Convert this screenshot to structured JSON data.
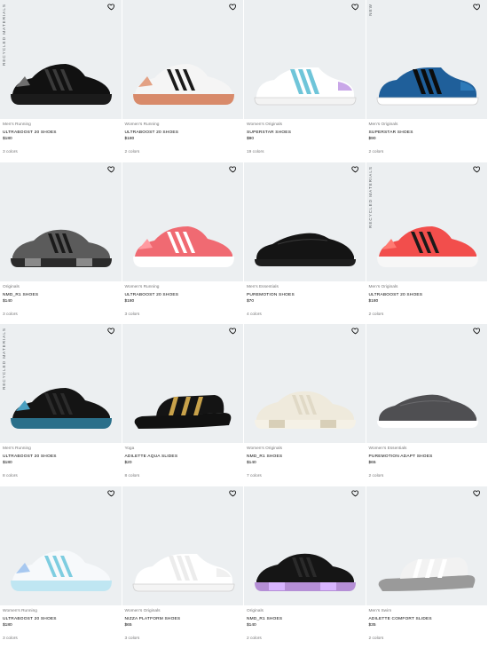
{
  "products": [
    {
      "category": "Men's Running",
      "name": "ULTRABOOST 20 SHOES",
      "price": "$180",
      "colors": "3 colors",
      "badge": "RECYCLED MATERIALS",
      "shoe": {
        "type": "runner",
        "body": "#111111",
        "sole": "#1b1b1b",
        "stripe": "#3a3a3a",
        "accent": "#6f6f6f"
      }
    },
    {
      "category": "Women's Running",
      "name": "ULTRABOOST 20 SHOES",
      "price": "$180",
      "colors": "2 colors",
      "badge": "",
      "shoe": {
        "type": "runner",
        "body": "#f5f5f5",
        "sole": "#d88a6a",
        "stripe": "#1a1a1a",
        "accent": "#e3a184"
      }
    },
    {
      "category": "Women's Originals",
      "name": "SUPERSTAR SHOES",
      "price": "$90",
      "colors": "19 colors",
      "badge": "",
      "shoe": {
        "type": "superstar",
        "body": "#ffffff",
        "sole": "#f3f3f3",
        "stripe": "#6fc5d9",
        "accent": "#c9a7e8"
      }
    },
    {
      "category": "Men's Originals",
      "name": "SUPERSTAR SHOES",
      "price": "$90",
      "colors": "2 colors",
      "badge": "NEW",
      "shoe": {
        "type": "superstar",
        "body": "#1f5f9a",
        "sole": "#ffffff",
        "stripe": "#0c0c0c",
        "accent": "#2d7ab9"
      }
    },
    {
      "category": "Originals",
      "name": "NMD_R1 SHOES",
      "price": "$140",
      "colors": "3 colors",
      "badge": "",
      "shoe": {
        "type": "nmd",
        "body": "#5b5b5b",
        "sole": "#2b2b2b",
        "stripe": "#1a1a1a",
        "accent": "#8a8a8a"
      }
    },
    {
      "category": "Women's Running",
      "name": "ULTRABOOST 20 SHOES",
      "price": "$180",
      "colors": "3 colors",
      "badge": "",
      "shoe": {
        "type": "runner",
        "body": "#f06a72",
        "sole": "#ffffff",
        "stripe": "#ffffff",
        "accent": "#ff9aa0"
      }
    },
    {
      "category": "Men's Essentials",
      "name": "PUREMOTION SHOES",
      "price": "$70",
      "colors": "4 colors",
      "badge": "",
      "shoe": {
        "type": "knit",
        "body": "#141414",
        "sole": "#1e1e1e",
        "stripe": "#262626",
        "accent": "#3a3a3a"
      }
    },
    {
      "category": "Men's Originals",
      "name": "ULTRABOOST 20 SHOES",
      "price": "$180",
      "colors": "2 colors",
      "badge": "RECYCLED MATERIALS",
      "shoe": {
        "type": "runner",
        "body": "#f24e4c",
        "sole": "#f7f7f7",
        "stripe": "#1a1a1a",
        "accent": "#ff7a72"
      }
    },
    {
      "category": "Men's Running",
      "name": "ULTRABOOST 20 SHOES",
      "price": "$180",
      "colors": "8 colors",
      "badge": "RECYCLED MATERIALS",
      "shoe": {
        "type": "runner",
        "body": "#141414",
        "sole": "#2a6f8a",
        "stripe": "#2b2b2b",
        "accent": "#4a9fc0"
      }
    },
    {
      "category": "Yoga",
      "name": "ADILETTE AQUA SLIDES",
      "price": "$20",
      "colors": "8 colors",
      "badge": "",
      "shoe": {
        "type": "slide",
        "body": "#141414",
        "sole": "#111111",
        "stripe": "#c9a24a",
        "accent": "#2a2a2a"
      }
    },
    {
      "category": "Women's Originals",
      "name": "NMD_R1 SHOES",
      "price": "$140",
      "colors": "7 colors",
      "badge": "",
      "shoe": {
        "type": "nmd",
        "body": "#efeadc",
        "sole": "#f5f1e6",
        "stripe": "#e0d9c6",
        "accent": "#d8cfb8"
      }
    },
    {
      "category": "Women's Essentials",
      "name": "PUREMOTION ADAPT SHOES",
      "price": "$65",
      "colors": "2 colors",
      "badge": "",
      "shoe": {
        "type": "knit",
        "body": "#4f4f52",
        "sole": "#ffffff",
        "stripe": "#5d5d60",
        "accent": "#6a6a6d"
      }
    },
    {
      "category": "Women's Running",
      "name": "ULTRABOOST 20 SHOES",
      "price": "$180",
      "colors": "3 colors",
      "badge": "",
      "shoe": {
        "type": "runner",
        "body": "#f7f9fb",
        "sole": "#bfe6f2",
        "stripe": "#7ecde0",
        "accent": "#a7c8f0"
      }
    },
    {
      "category": "Women's Originals",
      "name": "NIZZA PLATFORM SHOES",
      "price": "$65",
      "colors": "3 colors",
      "badge": "",
      "shoe": {
        "type": "superstar",
        "body": "#ffffff",
        "sole": "#f4f4f4",
        "stripe": "#ececec",
        "accent": "#f0f0f0"
      }
    },
    {
      "category": "Originals",
      "name": "NMD_R1 SHOES",
      "price": "$140",
      "colors": "2 colors",
      "badge": "",
      "shoe": {
        "type": "nmd",
        "body": "#151515",
        "sole": "#b58fd6",
        "stripe": "#2a2a2a",
        "accent": "#d8b4ff"
      }
    },
    {
      "category": "Men's Swim",
      "name": "ADILETTE COMFORT SLIDES",
      "price": "$35",
      "colors": "2 colors",
      "badge": "",
      "shoe": {
        "type": "slide",
        "body": "#f2f2f2",
        "sole": "#9a9a9a",
        "stripe": "#ffffff",
        "accent": "#bdbdbd"
      }
    }
  ]
}
